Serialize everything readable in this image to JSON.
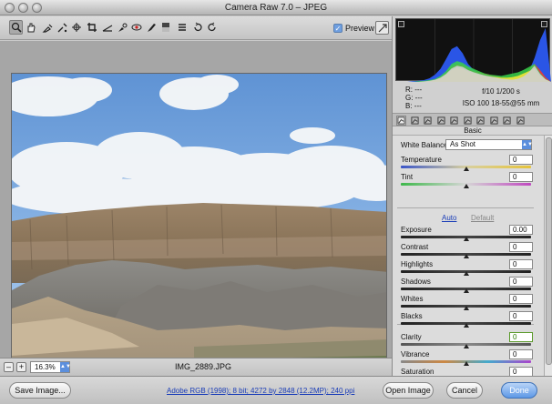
{
  "window": {
    "title": "Camera Raw 7.0  –  JPEG"
  },
  "toolbar": {
    "tools": [
      "zoom-icon",
      "hand-icon",
      "white-balance-icon",
      "color-sampler-icon",
      "targeted-adjustment-icon",
      "crop-icon",
      "straighten-icon",
      "spot-removal-icon",
      "red-eye-icon",
      "adjustment-brush-icon",
      "graduated-filter-icon",
      "preferences-icon",
      "rotate-left-icon",
      "rotate-right-icon"
    ],
    "preview_label": "Preview",
    "preview_checked": "✓"
  },
  "status": {
    "zoom": "16.3%",
    "filename": "IMG_2889.JPG",
    "minus": "–",
    "plus": "+"
  },
  "buttons": {
    "save": "Save Image...",
    "open": "Open Image",
    "cancel": "Cancel",
    "done": "Done"
  },
  "workflow": "Adobe RGB (1998); 8 bit; 4272 by 2848 (12.2MP); 240 ppi",
  "readout": {
    "r": "R:   ---",
    "g": "G:   ---",
    "b": "B:   ---",
    "aperture_shutter": "f/10   1/200 s",
    "iso_lens": "ISO 100   18-55@55 mm"
  },
  "panel": {
    "title": "Basic",
    "tabs": [
      "basic-icon",
      "tone-curve-icon",
      "detail-icon",
      "hsl-icon",
      "split-toning-icon",
      "lens-icon",
      "effects-icon",
      "camera-calibration-icon",
      "presets-icon",
      "snapshots-icon"
    ]
  },
  "basic": {
    "wb_label": "White Balance:",
    "wb_value": "As Shot",
    "auto": "Auto",
    "default": "Default",
    "sliders": [
      {
        "label": "Temperature",
        "value": "0",
        "pos": 0.5
      },
      {
        "label": "Tint",
        "value": "0",
        "pos": 0.5
      },
      {
        "label": "Exposure",
        "value": "0.00",
        "pos": 0.5
      },
      {
        "label": "Contrast",
        "value": "0",
        "pos": 0.5
      },
      {
        "label": "Highlights",
        "value": "0",
        "pos": 0.5
      },
      {
        "label": "Shadows",
        "value": "0",
        "pos": 0.5
      },
      {
        "label": "Whites",
        "value": "0",
        "pos": 0.5
      },
      {
        "label": "Blacks",
        "value": "0",
        "pos": 0.5
      },
      {
        "label": "Clarity",
        "value": "0",
        "pos": 0.5
      },
      {
        "label": "Vibrance",
        "value": "0",
        "pos": 0.5
      },
      {
        "label": "Saturation",
        "value": "0",
        "pos": 0.5
      }
    ]
  },
  "histogram": {
    "blue": [
      0,
      0,
      0,
      1,
      2,
      3,
      6,
      12,
      22,
      38,
      55,
      60,
      48,
      30,
      20,
      15,
      12,
      10,
      8,
      6,
      5,
      4,
      6,
      10,
      18,
      40,
      70,
      90,
      0
    ],
    "red": [
      0,
      0,
      0,
      0,
      0,
      1,
      2,
      4,
      8,
      15,
      25,
      30,
      28,
      22,
      18,
      16,
      14,
      12,
      10,
      8,
      7,
      6,
      8,
      12,
      20,
      30,
      20,
      8,
      0
    ],
    "green": [
      0,
      0,
      0,
      0,
      1,
      2,
      3,
      5,
      10,
      18,
      30,
      35,
      32,
      26,
      22,
      18,
      14,
      12,
      11,
      10,
      12,
      14,
      16,
      20,
      25,
      30,
      15,
      5,
      0
    ],
    "yellow": [
      0,
      0,
      0,
      0,
      0,
      0,
      1,
      3,
      6,
      12,
      20,
      24,
      22,
      18,
      15,
      12,
      10,
      9,
      8,
      7,
      7,
      8,
      10,
      14,
      18,
      22,
      10,
      4,
      0
    ]
  }
}
